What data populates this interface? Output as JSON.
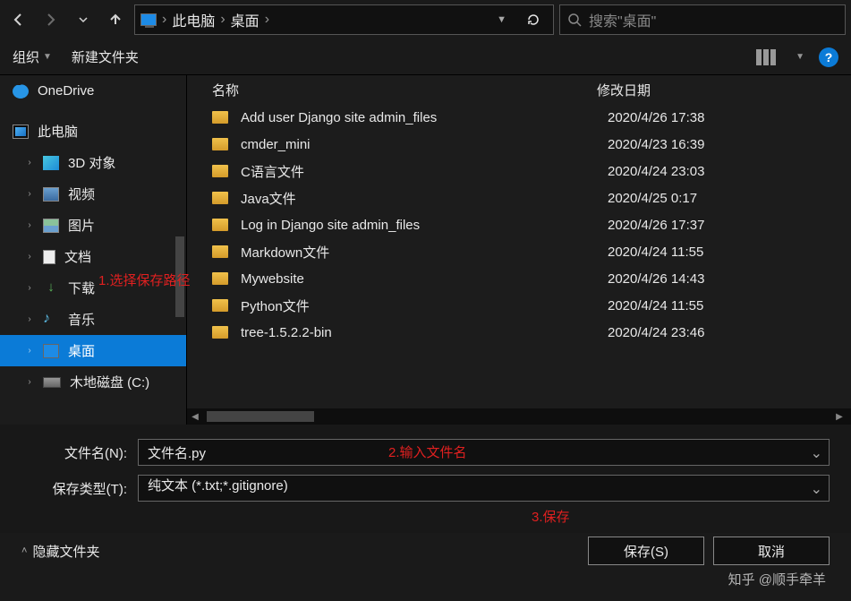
{
  "breadcrumb": {
    "item1": "此电脑",
    "item2": "桌面"
  },
  "search": {
    "placeholder": "搜索\"桌面\""
  },
  "toolbar": {
    "organize": "组织",
    "new_folder": "新建文件夹"
  },
  "sidebar": {
    "onedrive": "OneDrive",
    "this_pc": "此电脑",
    "items": [
      {
        "label": "3D 对象"
      },
      {
        "label": "视频"
      },
      {
        "label": "图片"
      },
      {
        "label": "文档"
      },
      {
        "label": "下载"
      },
      {
        "label": "音乐"
      },
      {
        "label": "桌面"
      },
      {
        "label": "木地磁盘 (C:)"
      }
    ]
  },
  "columns": {
    "name": "名称",
    "date": "修改日期"
  },
  "files": [
    {
      "name": "Add user   Django site admin_files",
      "date": "2020/4/26 17:38"
    },
    {
      "name": "cmder_mini",
      "date": "2020/4/23 16:39"
    },
    {
      "name": "C语言文件",
      "date": "2020/4/24 23:03"
    },
    {
      "name": "Java文件",
      "date": "2020/4/25 0:17"
    },
    {
      "name": "Log in   Django site admin_files",
      "date": "2020/4/26 17:37"
    },
    {
      "name": "Markdown文件",
      "date": "2020/4/24 11:55"
    },
    {
      "name": "Mywebsite",
      "date": "2020/4/26 14:43"
    },
    {
      "name": "Python文件",
      "date": "2020/4/24 11:55"
    },
    {
      "name": "tree-1.5.2.2-bin",
      "date": "2020/4/24 23:46"
    }
  ],
  "form": {
    "filename_label": "文件名(N):",
    "filename_value": "文件名.py",
    "type_label": "保存类型(T):",
    "type_value": "纯文本 (*.txt;*.gitignore)"
  },
  "footer": {
    "hide_folders": "隐藏文件夹",
    "save": "保存(S)",
    "cancel": "取消"
  },
  "annotations": {
    "a1": "1.选择保存路径",
    "a2": "2.输入文件名",
    "a3": "3.保存"
  },
  "watermark": "知乎 @顺手牵羊"
}
